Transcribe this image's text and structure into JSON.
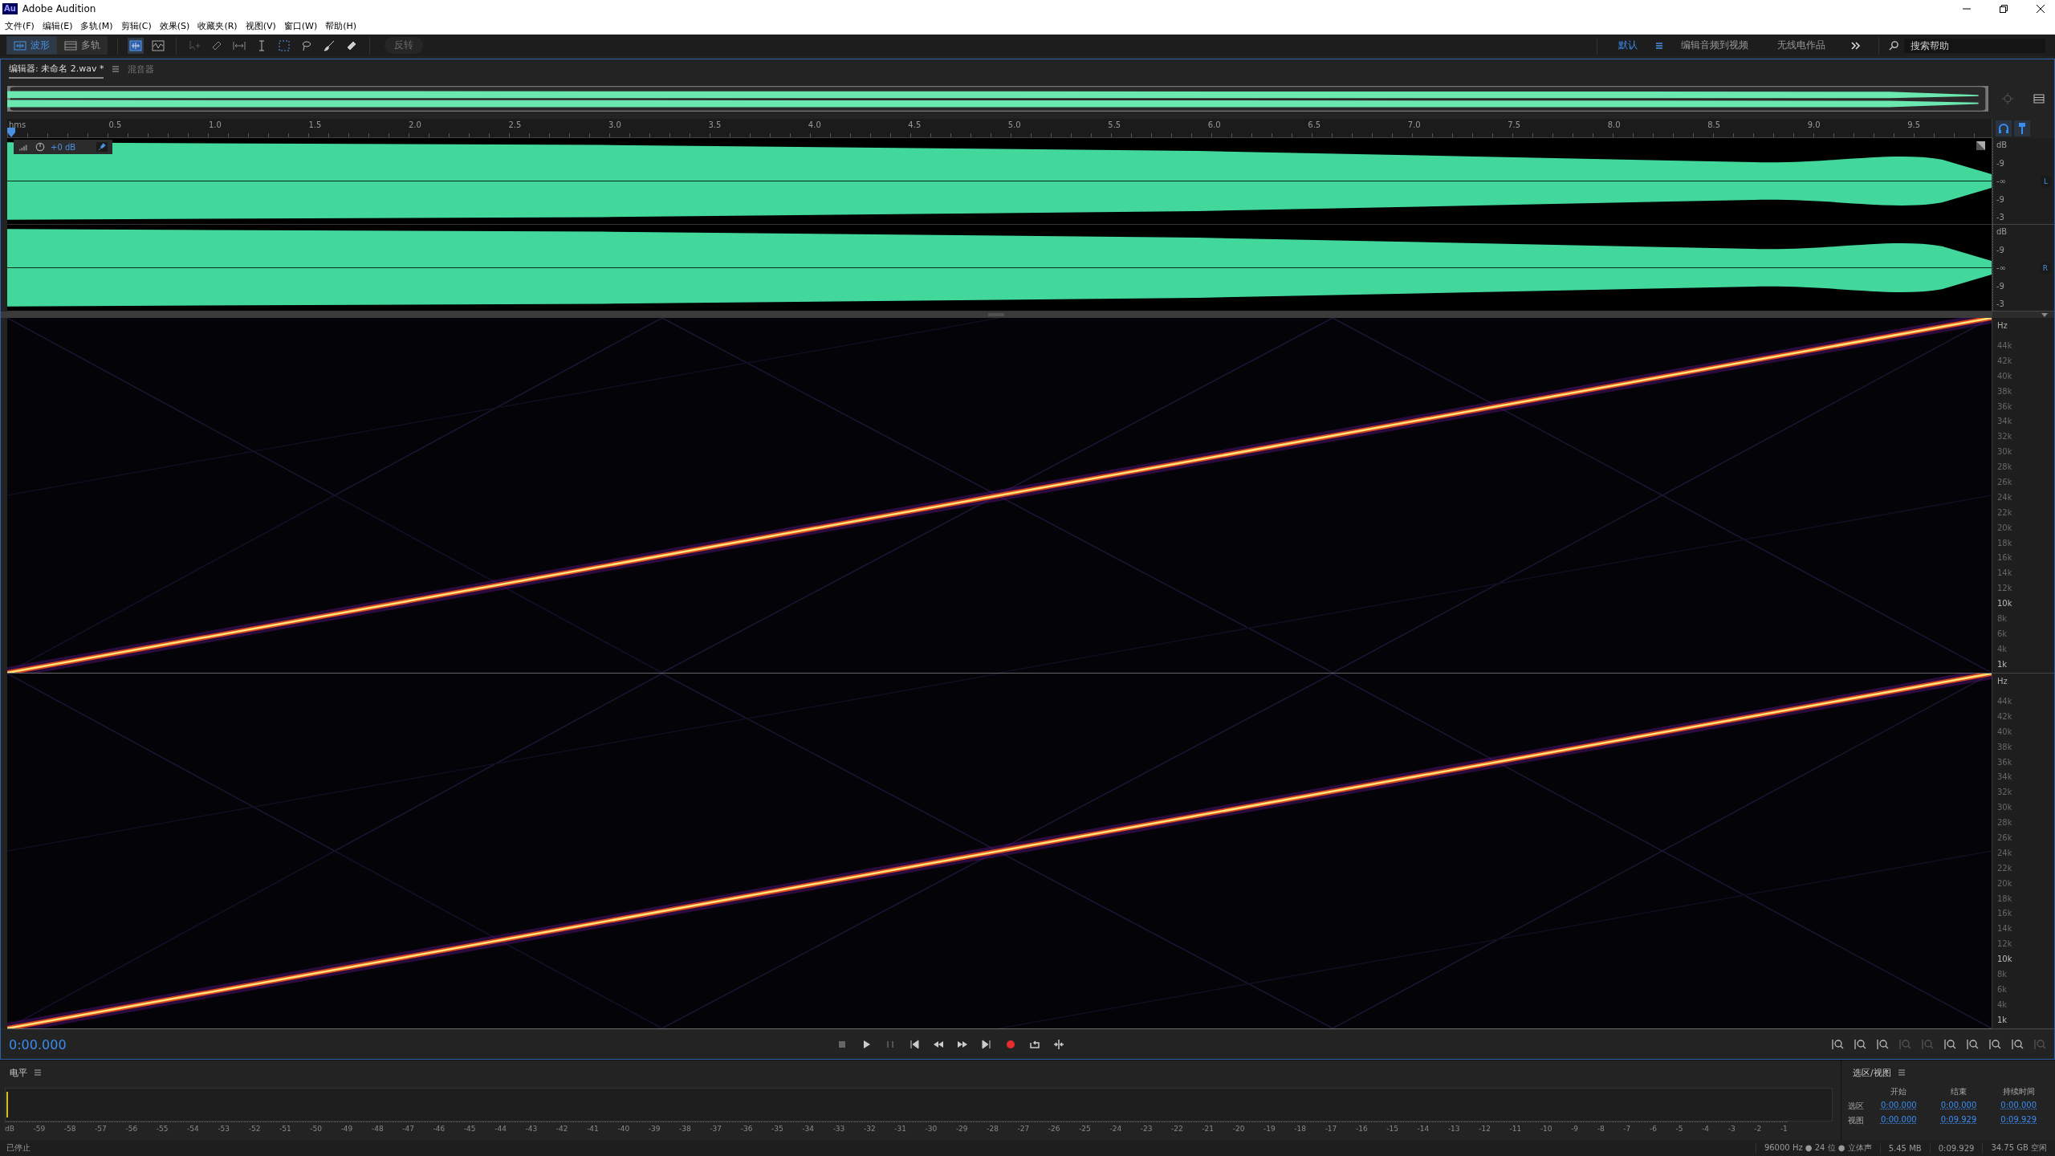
{
  "window": {
    "app_icon": "Au",
    "title": "Adobe Audition"
  },
  "menu": [
    "文件(F)",
    "编辑(E)",
    "多轨(M)",
    "剪辑(C)",
    "效果(S)",
    "收藏夹(R)",
    "视图(V)",
    "窗口(W)",
    "帮助(H)"
  ],
  "toolbar": {
    "views": [
      {
        "label": "波形",
        "selected": true
      },
      {
        "label": "多轨",
        "selected": false
      }
    ],
    "invert_button": {
      "label": "反转",
      "disabled": true
    }
  },
  "workspaces": [
    {
      "label": "默认",
      "selected": true
    },
    {
      "label": "编辑音频到视频",
      "selected": false
    },
    {
      "label": "无线电作品",
      "selected": false
    }
  ],
  "search": {
    "placeholder": "搜索帮助"
  },
  "panel_tabs": [
    {
      "label": "编辑器: 未命名 2.wav *",
      "selected": true
    },
    {
      "label": "混音器",
      "selected": false
    }
  ],
  "ruler": {
    "labels": [
      "hms",
      "0.5",
      "1.0",
      "1.5",
      "2.0",
      "2.5",
      "3.0",
      "3.5",
      "4.0",
      "4.5",
      "5.0",
      "5.5",
      "6.0",
      "6.5",
      "7.0",
      "7.5",
      "8.0",
      "8.5",
      "9.0",
      "9.5"
    ]
  },
  "clip_gain": "+0 dB",
  "channels": [
    {
      "label": "L",
      "db_labels": [
        "dB",
        "-9",
        "-∞",
        "-9",
        "-3"
      ]
    },
    {
      "label": "R",
      "db_labels": [
        "dB",
        "-9",
        "-∞",
        "-9",
        "-3"
      ]
    }
  ],
  "frequency_axes": [
    {
      "unit": "Hz",
      "labels": [
        {
          "text": "44k",
          "major": false
        },
        {
          "text": "42k",
          "major": false
        },
        {
          "text": "40k",
          "major": false
        },
        {
          "text": "38k",
          "major": false
        },
        {
          "text": "36k",
          "major": false
        },
        {
          "text": "34k",
          "major": false
        },
        {
          "text": "32k",
          "major": false
        },
        {
          "text": "30k",
          "major": false
        },
        {
          "text": "28k",
          "major": false
        },
        {
          "text": "26k",
          "major": false
        },
        {
          "text": "24k",
          "major": false
        },
        {
          "text": "22k",
          "major": false
        },
        {
          "text": "20k",
          "major": false
        },
        {
          "text": "18k",
          "major": false
        },
        {
          "text": "16k",
          "major": false
        },
        {
          "text": "14k",
          "major": false
        },
        {
          "text": "12k",
          "major": false
        },
        {
          "text": "10k",
          "major": true
        },
        {
          "text": "8k",
          "major": false
        },
        {
          "text": "6k",
          "major": false
        },
        {
          "text": "4k",
          "major": false
        },
        {
          "text": "1k",
          "major": true
        }
      ]
    },
    {
      "unit": "Hz",
      "labels": [
        {
          "text": "44k",
          "major": false
        },
        {
          "text": "42k",
          "major": false
        },
        {
          "text": "40k",
          "major": false
        },
        {
          "text": "38k",
          "major": false
        },
        {
          "text": "36k",
          "major": false
        },
        {
          "text": "34k",
          "major": false
        },
        {
          "text": "32k",
          "major": false
        },
        {
          "text": "30k",
          "major": false
        },
        {
          "text": "28k",
          "major": false
        },
        {
          "text": "26k",
          "major": false
        },
        {
          "text": "24k",
          "major": false
        },
        {
          "text": "22k",
          "major": false
        },
        {
          "text": "20k",
          "major": false
        },
        {
          "text": "18k",
          "major": false
        },
        {
          "text": "16k",
          "major": false
        },
        {
          "text": "14k",
          "major": false
        },
        {
          "text": "12k",
          "major": false
        },
        {
          "text": "10k",
          "major": true
        },
        {
          "text": "8k",
          "major": false
        },
        {
          "text": "6k",
          "major": false
        },
        {
          "text": "4k",
          "major": false
        },
        {
          "text": "1k",
          "major": true
        }
      ]
    }
  ],
  "transport": {
    "time": "0:00.000"
  },
  "levels": {
    "title": "电平",
    "scale": [
      "dB",
      "-59",
      "-58",
      "-57",
      "-56",
      "-55",
      "-54",
      "-53",
      "-52",
      "-51",
      "-50",
      "-49",
      "-48",
      "-47",
      "-46",
      "-45",
      "-44",
      "-43",
      "-42",
      "-41",
      "-40",
      "-39",
      "-38",
      "-37",
      "-36",
      "-35",
      "-34",
      "-33",
      "-32",
      "-31",
      "-30",
      "-29",
      "-28",
      "-27",
      "-26",
      "-25",
      "-24",
      "-23",
      "-22",
      "-21",
      "-20",
      "-19",
      "-18",
      "-17",
      "-16",
      "-15",
      "-14",
      "-13",
      "-12",
      "-11",
      "-10",
      "-9",
      "-8",
      "-7",
      "-6",
      "-5",
      "-4",
      "-3",
      "-2",
      "-1"
    ]
  },
  "selection_view": {
    "title": "选区/视图",
    "columns": [
      "开始",
      "结束",
      "持续时间"
    ],
    "rows": [
      {
        "label": "选区",
        "values": [
          "0:00.000",
          "0:00.000",
          "0:00.000"
        ]
      },
      {
        "label": "视图",
        "values": [
          "0:00.000",
          "0:09.929",
          "0:09.929"
        ]
      }
    ]
  },
  "status_bar": {
    "state": "已停止",
    "format": "96000 Hz ● 24 位 ● 立体声",
    "size": "5.45 MB",
    "duration": "0:09.929",
    "free": "34.75 GB 空闲"
  }
}
